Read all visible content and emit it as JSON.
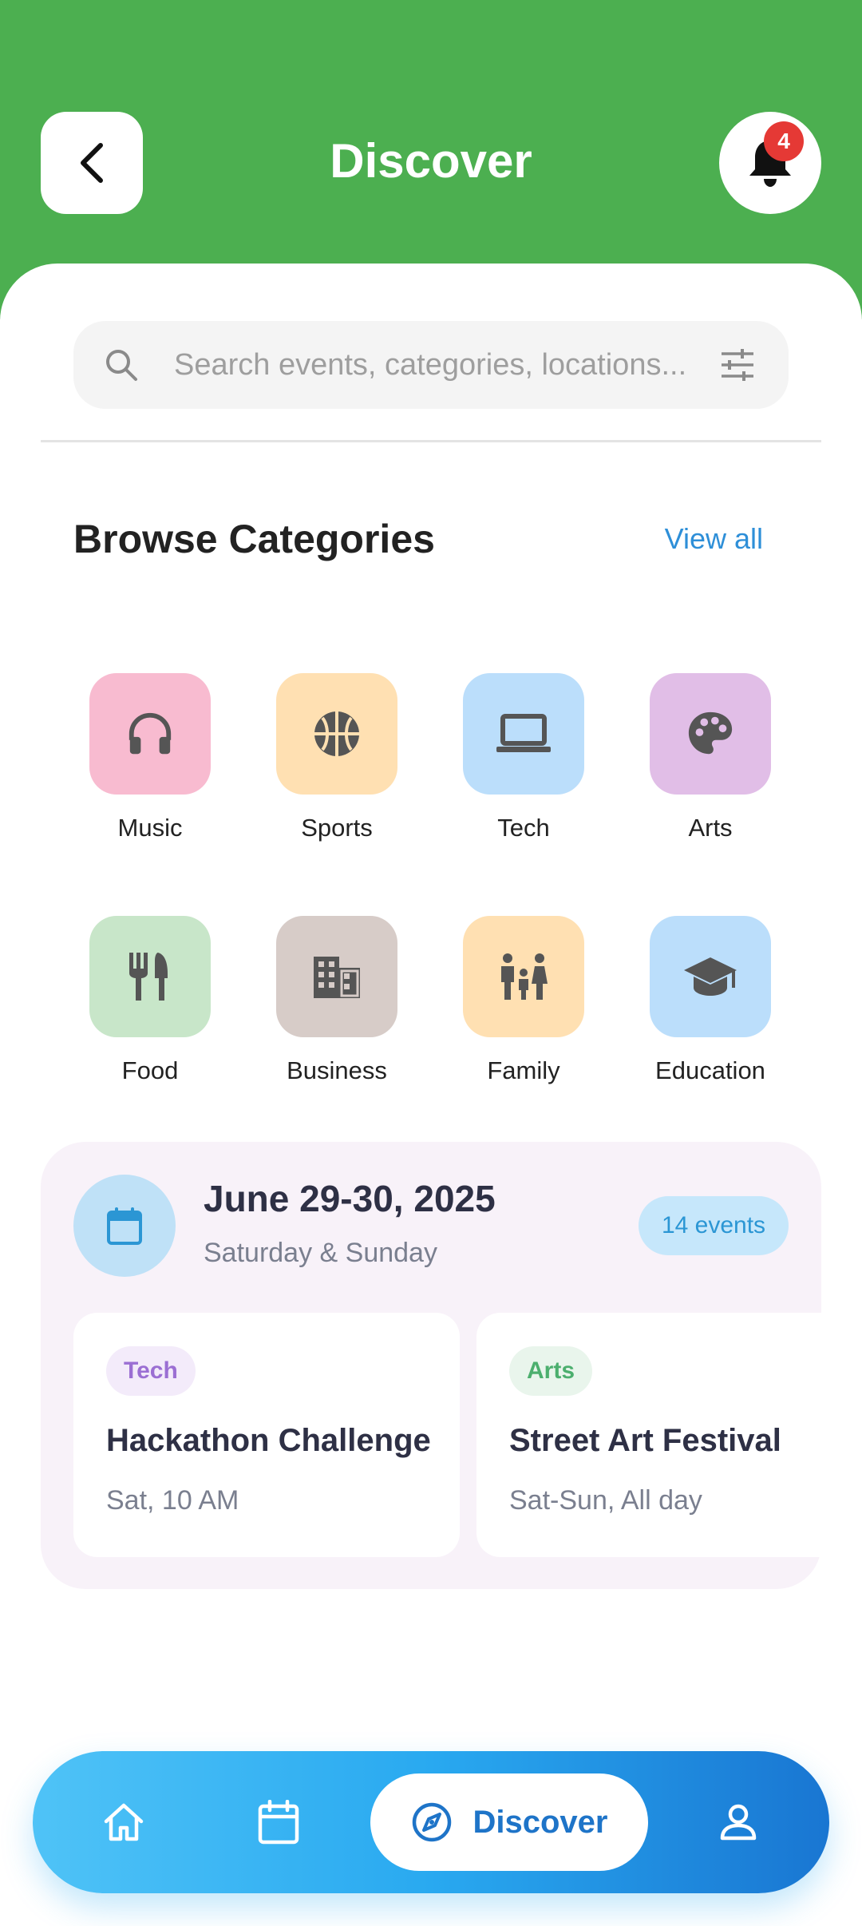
{
  "header": {
    "title": "Discover",
    "notification_count": "4",
    "background_color": "#4caf50"
  },
  "search": {
    "placeholder": "Search events, categories, locations..."
  },
  "categories_section": {
    "title": "Browse Categories",
    "view_all_label": "View all",
    "items": [
      {
        "label": "Music",
        "icon": "headphones-icon",
        "color": "#f8bbd0"
      },
      {
        "label": "Sports",
        "icon": "basketball-icon",
        "color": "#ffe0b2"
      },
      {
        "label": "Tech",
        "icon": "laptop-icon",
        "color": "#bbdefb"
      },
      {
        "label": "Arts",
        "icon": "palette-icon",
        "color": "#e1bee7"
      },
      {
        "label": "Food",
        "icon": "fork-knife-icon",
        "color": "#c8e6c9"
      },
      {
        "label": "Business",
        "icon": "building-icon",
        "color": "#d7ccc8"
      },
      {
        "label": "Family",
        "icon": "family-icon",
        "color": "#ffe0b2"
      },
      {
        "label": "Education",
        "icon": "graduation-cap-icon",
        "color": "#bbdefb"
      }
    ]
  },
  "weekend": {
    "date_title": "June 29-30, 2025",
    "date_subtitle": "Saturday & Sunday",
    "events_count_label": "14 events",
    "events": [
      {
        "tag": "Tech",
        "tag_color": "#9b6fd3",
        "title": "Hackathon Challenge",
        "time": "Sat, 10 AM"
      },
      {
        "tag": "Arts",
        "tag_color": "#4caf6e",
        "title": "Street Art Festival",
        "time": "Sat-Sun, All day"
      }
    ]
  },
  "bottom_nav": {
    "active_label": "Discover",
    "items": [
      "home-icon",
      "calendar-icon",
      "compass-icon",
      "profile-icon"
    ]
  }
}
